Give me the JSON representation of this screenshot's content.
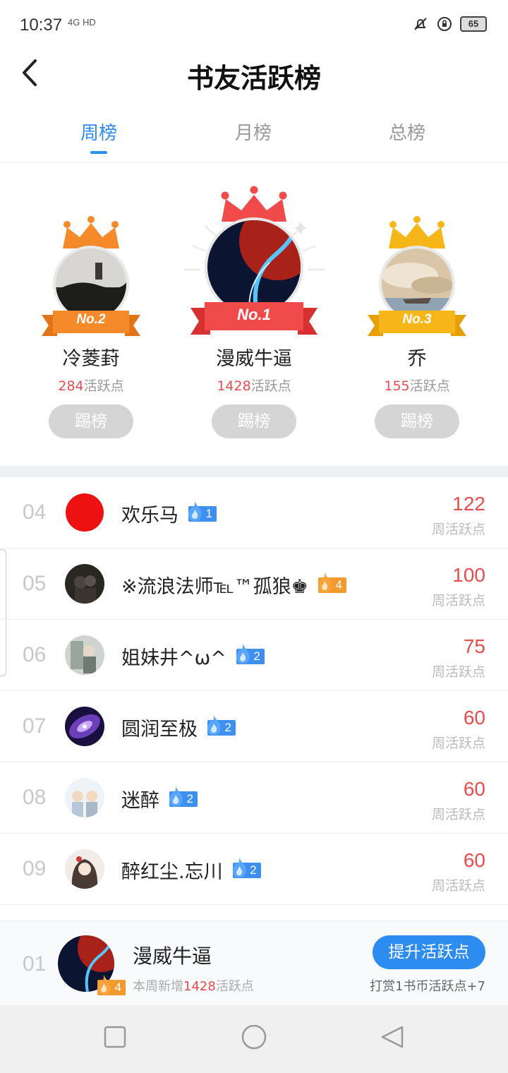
{
  "status_bar": {
    "time": "10:37",
    "network": "4G HD",
    "battery": "65"
  },
  "header": {
    "title": "书友活跃榜",
    "back_icon": "back-arrow-icon"
  },
  "tabs": [
    {
      "label": "周榜",
      "active": true
    },
    {
      "label": "月榜",
      "active": false
    },
    {
      "label": "总榜",
      "active": false
    }
  ],
  "podium": {
    "first": {
      "rank_label": "No.1",
      "name": "漫威牛逼",
      "points": "1428",
      "points_suffix": "活跃点",
      "button": "踢榜",
      "color": "#f04a4a"
    },
    "second": {
      "rank_label": "No.2",
      "name": "冷菱葑",
      "points": "284",
      "points_suffix": "活跃点",
      "button": "踢榜",
      "color": "#f58a2a"
    },
    "third": {
      "rank_label": "No.3",
      "name": "乔",
      "points": "155",
      "points_suffix": "活跃点",
      "button": "踢榜",
      "color": "#f7b618"
    }
  },
  "list": [
    {
      "rank": "04",
      "name": "欢乐马",
      "level": "1",
      "badge": "blue",
      "score": "122",
      "label": "周活跃点"
    },
    {
      "rank": "05",
      "name": "※流浪法师℡™孤狼♚",
      "level": "4",
      "badge": "orange",
      "score": "100",
      "label": "周活跃点"
    },
    {
      "rank": "06",
      "name": "姐妹井^ω^",
      "level": "2",
      "badge": "blue",
      "score": "75",
      "label": "周活跃点"
    },
    {
      "rank": "07",
      "name": "圆润至极",
      "level": "2",
      "badge": "blue",
      "score": "60",
      "label": "周活跃点"
    },
    {
      "rank": "08",
      "name": "迷醉",
      "level": "2",
      "badge": "blue",
      "score": "60",
      "label": "周活跃点"
    },
    {
      "rank": "09",
      "name": "醉红尘.忘川",
      "level": "2",
      "badge": "blue",
      "score": "60",
      "label": "周活跃点"
    }
  ],
  "my_rank": {
    "rank": "01",
    "name": "漫威牛逼",
    "level": "4",
    "sub_prefix": "本周新增",
    "sub_points": "1428",
    "sub_suffix": "活跃点",
    "button": "提升活跃点",
    "hint": "打赏1书币活跃点+7"
  },
  "nav": [
    "recent-apps-icon",
    "home-icon",
    "back-icon"
  ]
}
